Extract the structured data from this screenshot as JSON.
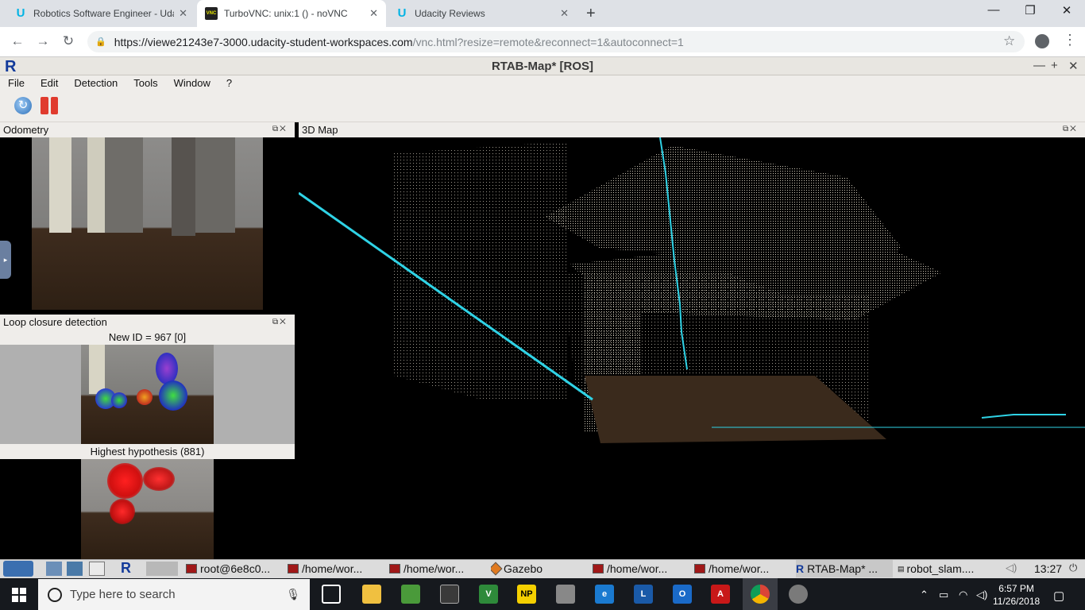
{
  "browser": {
    "tabs": [
      {
        "title": "Robotics Software Engineer - Uda",
        "favicon": "udacity-icon",
        "active": false
      },
      {
        "title": "TurboVNC: unix:1 () - noVNC",
        "favicon": "vnc-icon",
        "active": true
      },
      {
        "title": "Udacity Reviews",
        "favicon": "udacity-icon",
        "active": false
      }
    ],
    "url_host": "https://viewe21243e7-3000.udacity-student-workspaces.com",
    "url_path": "/vnc.html?resize=remote&reconnect=1&autoconnect=1"
  },
  "rtab": {
    "title": "RTAB-Map* [ROS]",
    "logo": "R",
    "menu": [
      "File",
      "Edit",
      "Detection",
      "Tools",
      "Window",
      "?"
    ],
    "odometry_title": "Odometry",
    "loop_title": "Loop closure detection",
    "new_id": "New ID = 967 [0]",
    "hypothesis": "Highest hypothesis (881)",
    "map_title": "3D Map"
  },
  "vnc_taskbar": {
    "items": [
      {
        "label": "root@6e8c0...",
        "icon": "terminal-icon"
      },
      {
        "label": "/home/wor...",
        "icon": "terminal-icon"
      },
      {
        "label": "/home/wor...",
        "icon": "terminal-icon"
      },
      {
        "label": "Gazebo",
        "icon": "gazebo-icon"
      },
      {
        "label": "/home/wor...",
        "icon": "terminal-icon"
      },
      {
        "label": "/home/wor...",
        "icon": "terminal-icon"
      },
      {
        "label": "RTAB-Map* ...",
        "icon": "rtabmap-icon"
      },
      {
        "label": "robot_slam....",
        "icon": "rviz-icon"
      }
    ],
    "clock": "13:27"
  },
  "windows": {
    "search_placeholder": "Type here to search",
    "time": "6:57 PM",
    "date": "11/26/2018"
  },
  "colors": {
    "cyan_trajectory": "#2fd3e6",
    "chrome_tabstrip": "#dee1e6",
    "udacity": "#02b3e4"
  }
}
